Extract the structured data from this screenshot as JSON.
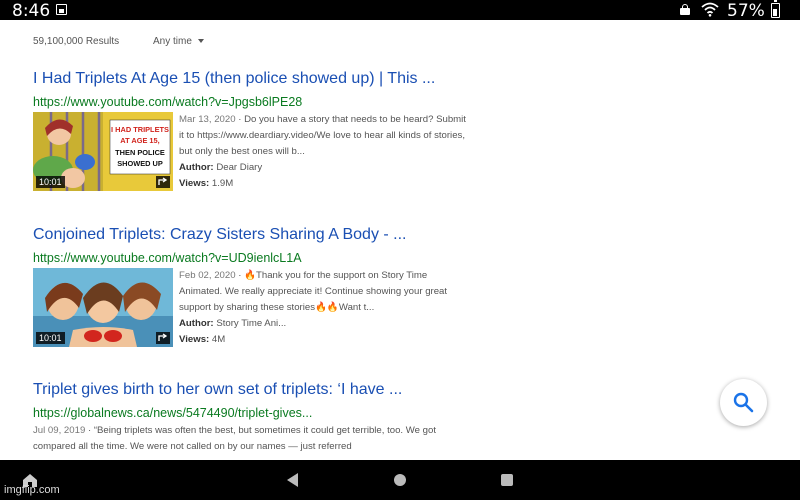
{
  "status_bar": {
    "time": "8:46",
    "battery": "57%",
    "icons": [
      "notification-icon",
      "lock-icon",
      "wifi-icon",
      "battery-icon"
    ]
  },
  "search_meta": {
    "results_count": "59,100,000 Results",
    "time_filter": "Any time"
  },
  "results": [
    {
      "title": "I Had Triplets At Age 15 (then police showed up) | This ...",
      "url": "https://www.youtube.com/watch?v=Jpgsb6lPE28",
      "date": "Mar 13, 2020",
      "snippet": "Do you have a story that needs to be heard? Submit it to https://www.deardiary.video/We love to hear all kinds of stories, but only the best ones will b...",
      "author_label": "Author:",
      "author": "Dear Diary",
      "views_label": "Views:",
      "views": "1.9M",
      "duration": "10:01",
      "thumb_text": [
        "I HAD TRIPLETS",
        "AT AGE 15,",
        "THEN POLICE",
        "SHOWED UP"
      ]
    },
    {
      "title": "Conjoined Triplets: Crazy Sisters Sharing A Body - ...",
      "url": "https://www.youtube.com/watch?v=UD9ienlcL1A",
      "date": "Feb 02, 2020",
      "snippet": "🔥Thank you for the support on Story Time Animated. We really appreciate it! Continue showing your great support by sharing these stories🔥🔥Want t...",
      "author_label": "Author:",
      "author": "Story Time Ani...",
      "views_label": "Views:",
      "views": "4M",
      "duration": "10:01"
    },
    {
      "title": "Triplet gives birth to her own set of triplets: ‘I have ...",
      "url": "https://globalnews.ca/news/5474490/triplet-gives...",
      "date": "Jul 09, 2019",
      "snippet": "“Being triplets was often the best, but sometimes it could get terrible, too. We got compared all the time. We were not called on by our names — just referred"
    }
  ],
  "fab": {
    "icon": "search-icon"
  },
  "nav_bar": {
    "icons": [
      "home-icon",
      "back-icon",
      "circle-home-icon",
      "recent-apps-icon"
    ]
  },
  "watermark": "imgflip.com",
  "colors": {
    "title": "#1a4fb3",
    "url": "#0a7a20",
    "fab_icon": "#1a73e8"
  }
}
